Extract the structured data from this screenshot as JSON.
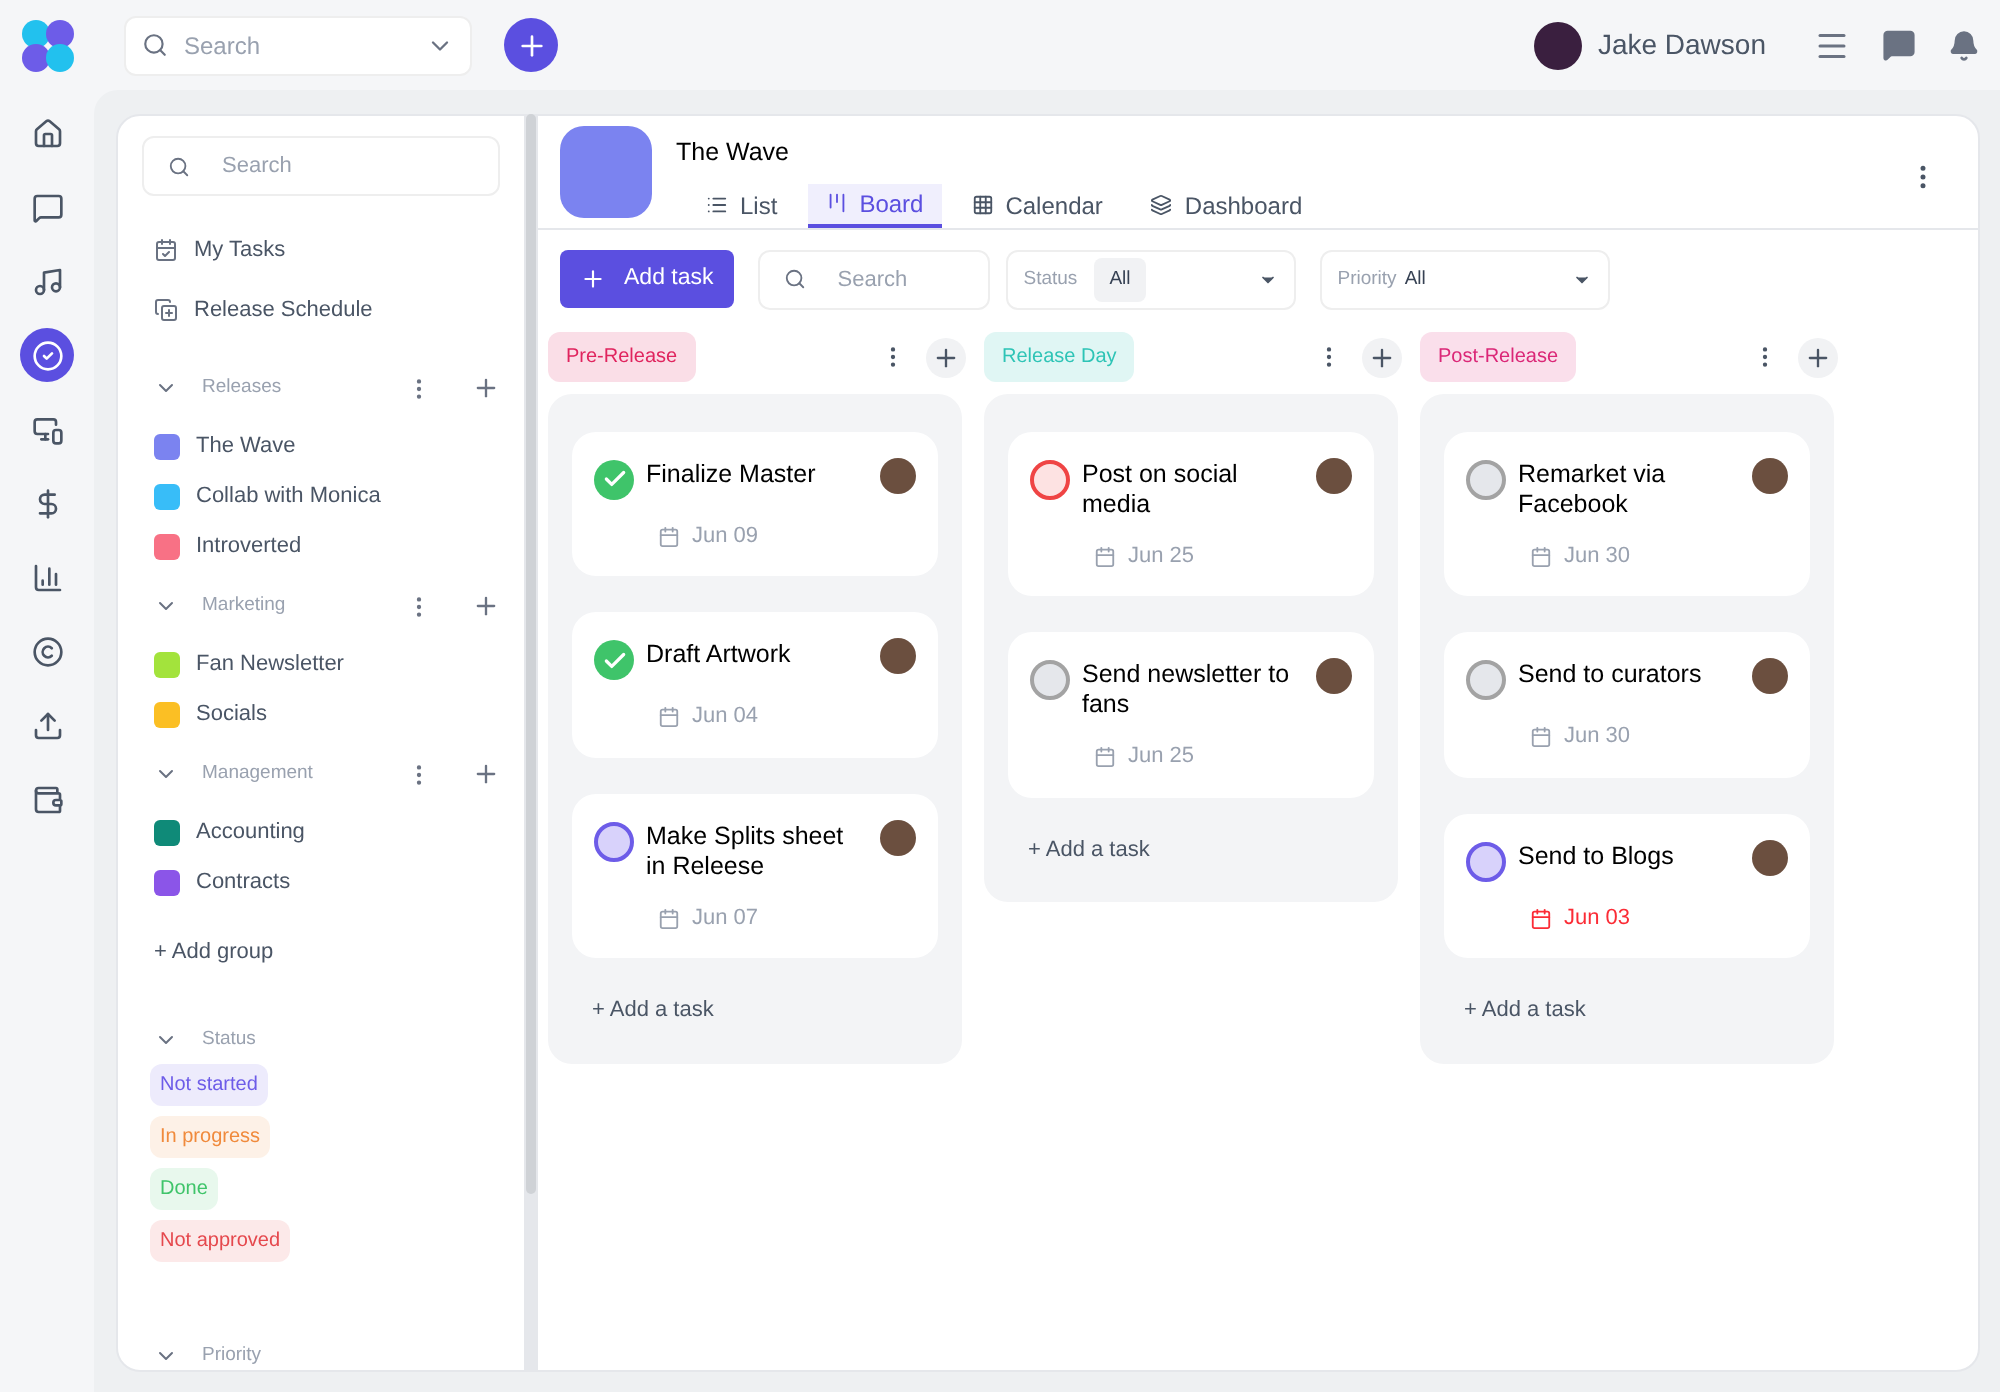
{
  "topbar": {
    "search_placeholder": "Search",
    "user_name": "Jake Dawson"
  },
  "rail": [
    {
      "selected": false
    },
    {
      "selected": false
    },
    {
      "selected": false
    },
    {
      "selected": true
    },
    {
      "selected": false
    },
    {
      "selected": false
    },
    {
      "selected": false
    },
    {
      "selected": false
    },
    {
      "selected": false
    },
    {
      "selected": false
    }
  ],
  "sidebar": {
    "search_placeholder": "Search",
    "links": [
      {
        "label": "My Tasks"
      },
      {
        "label": "Release Schedule"
      }
    ],
    "groups": [
      {
        "title": "Releases",
        "expanded": true,
        "items": [
          {
            "label": "The Wave",
            "color": "#7b83f0"
          },
          {
            "label": "Collab with Monica",
            "color": "#38bdf8"
          },
          {
            "label": "Introverted",
            "color": "#f87185"
          }
        ]
      },
      {
        "title": "Marketing",
        "expanded": true,
        "items": [
          {
            "label": "Fan Newsletter",
            "color": "#a3e33c"
          },
          {
            "label": "Socials",
            "color": "#fbbf24"
          }
        ]
      },
      {
        "title": "Management",
        "expanded": true,
        "items": [
          {
            "label": "Accounting",
            "color": "#0f8a78"
          },
          {
            "label": "Contracts",
            "color": "#8b55e8"
          }
        ]
      }
    ],
    "add_group": "+ Add group",
    "status_title": "Status",
    "status_expanded": true,
    "statuses": [
      {
        "label": "Not started",
        "color": "#6d5ce8"
      },
      {
        "label": "In progress",
        "color": "#f08a3c"
      },
      {
        "label": "Done",
        "color": "#3fc46a"
      },
      {
        "label": "Not approved",
        "color": "#e5484d"
      }
    ],
    "priority_title": "Priority"
  },
  "project": {
    "title": "The Wave",
    "color": "#7b83f0",
    "tabs": [
      {
        "label": "List",
        "selected": false
      },
      {
        "label": "Board",
        "selected": true
      },
      {
        "label": "Calendar",
        "selected": false
      },
      {
        "label": "Dashboard",
        "selected": false
      }
    ]
  },
  "toolbar": {
    "add_task": "Add task",
    "search_placeholder": "Search",
    "status_label": "Status",
    "status_value": "All",
    "priority_label": "Priority",
    "priority_value": "All"
  },
  "columns": [
    {
      "title": "Pre-Release",
      "color": "#e0245e",
      "add": "+ Add a task",
      "tasks": [
        {
          "title": "Finalize Master",
          "kind": "done",
          "date": "Jun 09",
          "overdue": false
        },
        {
          "title": "Draft Artwork",
          "kind": "done",
          "date": "Jun 04",
          "overdue": false
        },
        {
          "title": "Make Splits sheet in Releese",
          "kind": "in_progress",
          "date": "Jun 07",
          "overdue": false
        }
      ]
    },
    {
      "title": "Release Day",
      "color": "#2ec4b6",
      "add": "+ Add a task",
      "tasks": [
        {
          "title": "Post on social media",
          "kind": "not_approved",
          "date": "Jun 25",
          "overdue": false
        },
        {
          "title": "Send newsletter to fans",
          "kind": "not_started",
          "date": "Jun 25",
          "overdue": false
        }
      ]
    },
    {
      "title": "Post-Release",
      "color": "#db2777",
      "add": "+ Add a task",
      "tasks": [
        {
          "title": "Remarket via Facebook",
          "kind": "not_started",
          "date": "Jun 30",
          "overdue": false
        },
        {
          "title": "Send to curators",
          "kind": "not_started",
          "date": "Jun 30",
          "overdue": false
        },
        {
          "title": "Send to Blogs",
          "kind": "in_progress",
          "date": "Jun 03",
          "overdue": true
        }
      ]
    }
  ]
}
